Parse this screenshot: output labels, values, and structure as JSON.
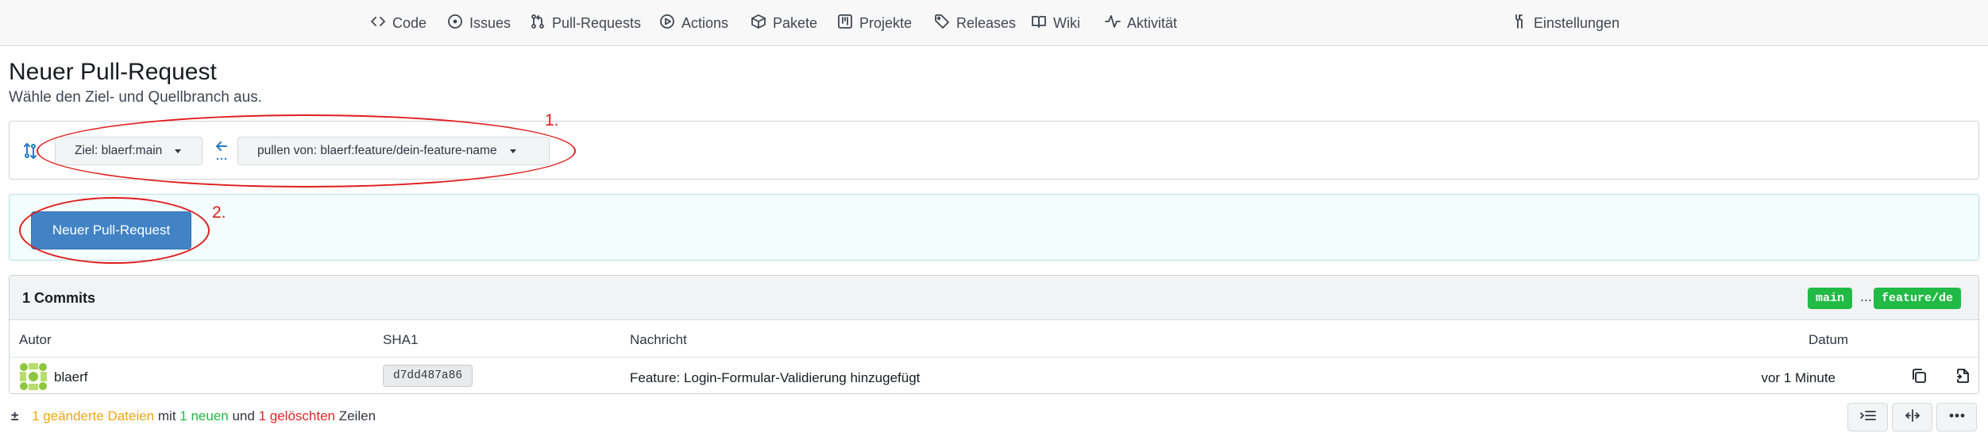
{
  "nav": {
    "items": [
      {
        "label": "Code",
        "icon": "code-icon"
      },
      {
        "label": "Issues",
        "icon": "issue-icon"
      },
      {
        "label": "Pull-Requests",
        "icon": "pull-request-icon"
      },
      {
        "label": "Actions",
        "icon": "play-icon"
      },
      {
        "label": "Pakete",
        "icon": "package-icon"
      },
      {
        "label": "Projekte",
        "icon": "project-icon"
      },
      {
        "label": "Releases",
        "icon": "tag-icon"
      },
      {
        "label": "Wiki",
        "icon": "book-icon"
      },
      {
        "label": "Aktivität",
        "icon": "pulse-icon"
      }
    ],
    "settings": {
      "label": "Einstellungen",
      "icon": "tools-icon"
    }
  },
  "header": {
    "title": "Neuer Pull-Request",
    "subtitle": "Wähle den Ziel- und Quellbranch aus."
  },
  "branches": {
    "target_label": "Ziel: blaerf:main",
    "source_label": "pullen von: blaerf:feature/dein-feature-name"
  },
  "new_pr": {
    "button_label": "Neuer Pull-Request"
  },
  "commits": {
    "count_label": "1 Commits",
    "base_tag": "main",
    "separator": "...",
    "head_tag": "feature/de",
    "columns": [
      "Autor",
      "SHA1",
      "Nachricht",
      "Datum"
    ],
    "rows": [
      {
        "author": "blaerf",
        "sha": "d7dd487a86",
        "message": "Feature: Login-Formular-Validierung hinzugefügt",
        "date": "vor 1 Minute"
      }
    ]
  },
  "stats": {
    "symbol": "±",
    "changed": "1 geänderte Dateien",
    "mit": "mit",
    "added": "1 neuen",
    "und": "und",
    "deleted": "1 gelöschten",
    "zeilen": "Zeilen"
  },
  "annotations": {
    "step1": "1.",
    "step2": "2.",
    "color": "#e11d1d"
  },
  "colors": {
    "primary_button": "#4183c4",
    "branch_tag": "#21ba45",
    "changed": "#f2a60f",
    "added": "#21ba45",
    "deleted": "#db2828"
  }
}
